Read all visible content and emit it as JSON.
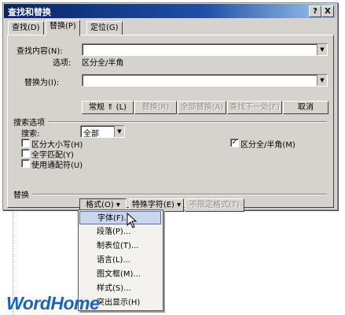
{
  "dialog": {
    "title": "查找和替换",
    "help_label": "?",
    "close_label": "X"
  },
  "tabs": [
    {
      "label": "查找(D)"
    },
    {
      "label": "替换(P)"
    },
    {
      "label": "定位(G)"
    }
  ],
  "find": {
    "label": "查找内容(N):",
    "value": "",
    "options_label": "选项:",
    "options_value": "区分全/半角"
  },
  "replace": {
    "label": "替换为(I):",
    "value": ""
  },
  "buttons": {
    "normal": "常规 ⇑ (L)",
    "replace": "替换(R)",
    "replace_all": "全部替换(A)",
    "find_next": "查找下一处(F)",
    "cancel": "取消"
  },
  "search_options": {
    "section_label": "搜索选项",
    "search_label": "搜索:",
    "search_value": "全部",
    "match_case": {
      "label": "区分大小写(H)",
      "checked": false
    },
    "whole_word": {
      "label": "全字匹配(Y)",
      "checked": false
    },
    "wildcards": {
      "label": "使用通配符(U)",
      "checked": false
    },
    "width_match": {
      "label": "区分全/半角(M)",
      "checked": true
    }
  },
  "replace_section": {
    "label": "替换",
    "format_button": "格式(O) ▾",
    "special_button": "特殊字符(E) ▾",
    "no_format_button": "不限定格式(T)"
  },
  "format_menu": [
    {
      "label": "字体(F)...",
      "highlighted": true
    },
    {
      "label": "段落(P)..."
    },
    {
      "label": "制表位(T)..."
    },
    {
      "label": "语言(L)..."
    },
    {
      "label": "图文框(M)..."
    },
    {
      "label": "样式(S)..."
    },
    {
      "label": "突出显示(H)"
    }
  ],
  "watermark": {
    "text": "WordHome"
  },
  "colors": {
    "titlebar": "#0a246a",
    "dialog_bg": "#d6d3ce",
    "watermark": "#1a62c4"
  }
}
